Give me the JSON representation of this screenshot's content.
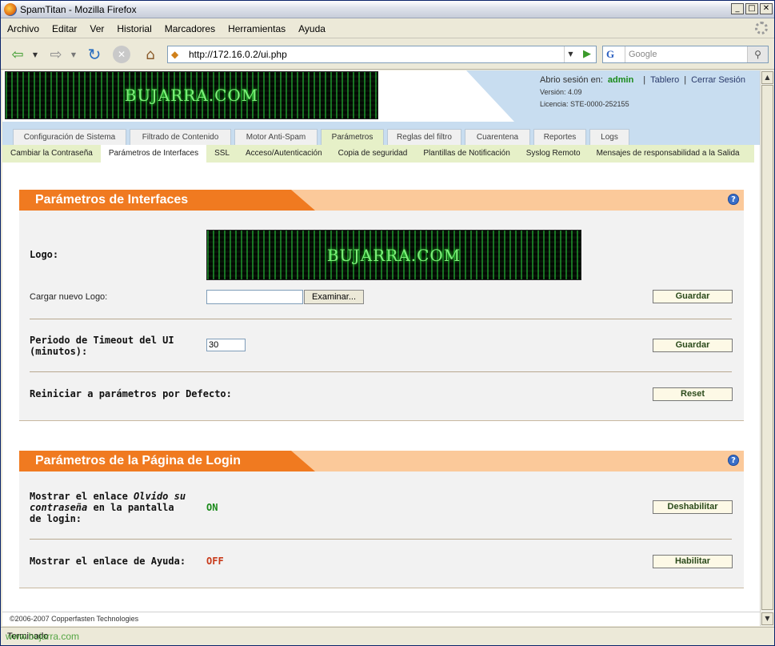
{
  "window": {
    "title": "SpamTitan - Mozilla Firefox"
  },
  "menu": [
    "Archivo",
    "Editar",
    "Ver",
    "Historial",
    "Marcadores",
    "Herramientas",
    "Ayuda"
  ],
  "address": {
    "url": "http://172.16.0.2/ui.php"
  },
  "search": {
    "placeholder": "Google",
    "engine_letter": "G"
  },
  "header": {
    "logo_text": "BUJARRA.COM",
    "session_label": "Abrio sesión en:",
    "user": "admin",
    "dashboard_link": "Tablero",
    "logout_link": "Cerrar Sesión",
    "version": "Versión: 4.09",
    "license": "Licencia: STE-0000-252155"
  },
  "tabs": [
    {
      "label": "Configuración de Sistema"
    },
    {
      "label": "Filtrado de Contenido"
    },
    {
      "label": "Motor Anti-Spam"
    },
    {
      "label": "Parámetros"
    },
    {
      "label": "Reglas del filtro"
    },
    {
      "label": "Cuarentena"
    },
    {
      "label": "Reportes"
    },
    {
      "label": "Logs"
    }
  ],
  "active_tab": "Parámetros",
  "subnav": [
    {
      "label": "Cambiar la Contraseña"
    },
    {
      "label": "Parámetros de Interfaces"
    },
    {
      "label": "SSL"
    },
    {
      "label": "Acceso/Autenticación"
    },
    {
      "label": "Copia de seguridad"
    },
    {
      "label": "Plantillas de Notificación"
    },
    {
      "label": "Syslog Remoto"
    },
    {
      "label": "Mensajes de responsabilidad a la Salida"
    }
  ],
  "active_subnav": "Parámetros de Interfaces",
  "interfaces_panel": {
    "title": "Parámetros de Interfaces",
    "logo_label": "Logo:",
    "logo_text": "BUJARRA.COM",
    "upload_label": "Cargar nuevo Logo:",
    "browse_label": "Examinar...",
    "save_label_1": "Guardar",
    "timeout_label": "Periodo de Timeout del UI (minutos):",
    "timeout_value": "30",
    "save_label_2": "Guardar",
    "reset_label_text": "Reiniciar a parámetros por Defecto:",
    "reset_button": "Reset"
  },
  "login_panel": {
    "title": "Parámetros de la Página de Login",
    "forgot_label_pre": "Mostrar el enlace ",
    "forgot_label_em": "Olvido su contraseña",
    "forgot_label_post": " en la pantalla de login:",
    "forgot_state": "ON",
    "forgot_button": "Deshabilitar",
    "help_label": "Mostrar el enlace de Ayuda:",
    "help_state": "OFF",
    "help_button": "Habilitar"
  },
  "footer": "©2006-2007 Copperfasten Technologies",
  "status": "Terminado",
  "watermark": "www.bujarra.com",
  "colors": {
    "panel_orange": "#f07a20",
    "panel_peach": "#fbc99a",
    "header_blue": "#c8ddf0",
    "subnav_green": "#e6f0c8",
    "on_green": "#1a8a1a",
    "off_red": "#c83a1a"
  }
}
